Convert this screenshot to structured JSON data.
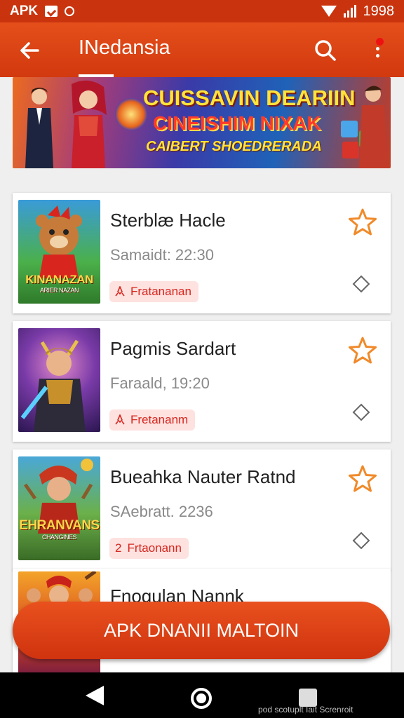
{
  "status_bar": {
    "app_label": "APK",
    "time": "1998"
  },
  "app_bar": {
    "title": "INedansia"
  },
  "banner": {
    "line1": "CUISSAVIN DEARIIN",
    "line2": "CINEISHIM NIXAK",
    "line3": "CAIBERT SHOEDRERADA"
  },
  "games": [
    {
      "name": "Sterblæ Hacle",
      "date": "Samaidt: 22:30",
      "tag": "Fratananan",
      "thumb_title": "KINANAZAN",
      "thumb_sub": "ARIER NAZAN"
    },
    {
      "name": "Pagmis Sardart",
      "date": "Faraald, 19:20",
      "tag": "Fretananm"
    },
    {
      "name": "Bueahka Nauter Ratnd",
      "date": "SAebratt. 2236",
      "tag": "Frtaonann",
      "tag_icon": "2",
      "thumb_title": "EHRANVANS",
      "thumb_sub": "CHANGINES"
    },
    {
      "name": "Fnogulan Nannk"
    }
  ],
  "fab": {
    "label": "APK DNANII MALTOIN"
  },
  "watermark": "pod scotuplt Iait Screnroit",
  "colors": {
    "accent": "#d63a10",
    "tag_bg": "#fde2e0",
    "tag_text": "#d8261e",
    "star": "#f08a2a"
  },
  "icons": [
    "arrow-left-icon",
    "search-icon",
    "more-vert-icon",
    "star-outline-icon",
    "diamond-outline-icon",
    "rocket-icon",
    "back-triangle-icon",
    "home-circle-icon",
    "recent-square-icon"
  ]
}
